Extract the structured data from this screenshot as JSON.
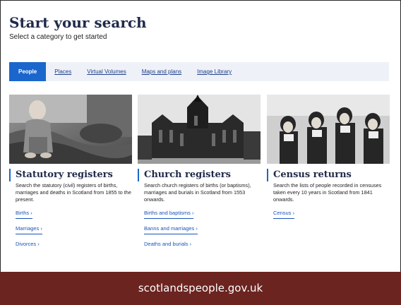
{
  "header": {
    "title": "Start your search",
    "subtitle": "Select a category to get started"
  },
  "tabs": [
    {
      "label": "People",
      "active": true
    },
    {
      "label": "Places",
      "active": false
    },
    {
      "label": "Virtual Volumes",
      "active": false
    },
    {
      "label": "Maps and plans",
      "active": false
    },
    {
      "label": "Image Library",
      "active": false
    }
  ],
  "cards": [
    {
      "title": "Statutory registers",
      "description": "Search the statutory (civil) registers of births, marriages and deaths in Scotland from 1855 to the present.",
      "links": [
        "Births ›",
        "Marriages ›",
        "Divorces ›"
      ]
    },
    {
      "title": "Church registers",
      "description": "Search church registers of births (or baptisms), marriages and burials in Scotland from 1553 onwards.",
      "links": [
        "Births and baptisms ›",
        "Banns and marriages ›",
        "Deaths and burials ›"
      ]
    },
    {
      "title": "Census returns",
      "description": "Search the lists of people recorded in censuses taken every 10 years in Scotland from 1841 onwards.",
      "links": [
        "Census ›"
      ]
    }
  ],
  "footer": {
    "caption": "scotlandspeople.gov.uk"
  },
  "colors": {
    "accent": "#1a66cc",
    "heading": "#1f2a4a",
    "footer_bg": "#6b2420"
  }
}
